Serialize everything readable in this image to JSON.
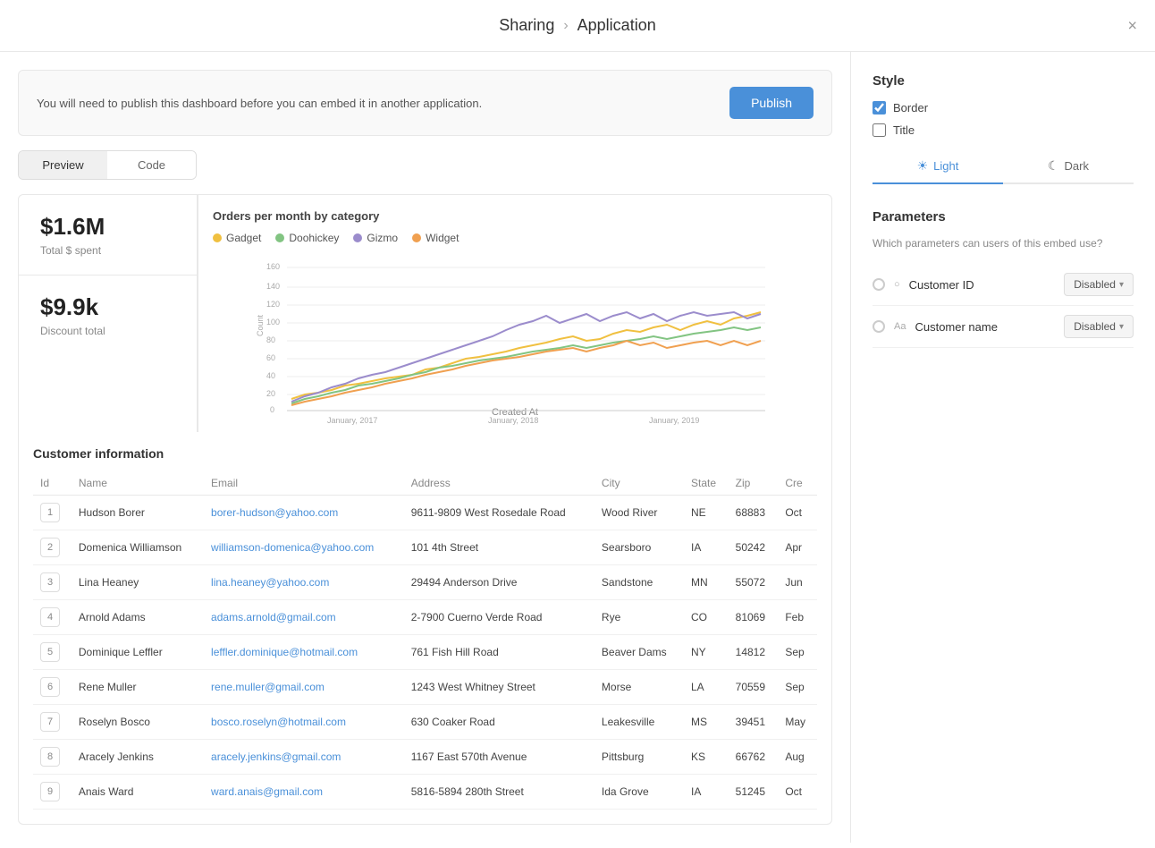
{
  "header": {
    "breadcrumb_sharing": "Sharing",
    "breadcrumb_application": "Application",
    "close_label": "×"
  },
  "publish_banner": {
    "message": "You will need to publish this dashboard before you can embed it in another application.",
    "button_label": "Publish"
  },
  "tabs": [
    {
      "id": "preview",
      "label": "Preview",
      "active": true
    },
    {
      "id": "code",
      "label": "Code",
      "active": false
    }
  ],
  "metrics": [
    {
      "value": "$1.6M",
      "label": "Total $ spent"
    },
    {
      "value": "$9.9k",
      "label": "Discount total"
    }
  ],
  "chart": {
    "title": "Orders per month by category",
    "x_label": "Created At",
    "y_label": "Count",
    "x_ticks": [
      "January, 2017",
      "January, 2018",
      "January, 2019"
    ],
    "legend": [
      {
        "name": "Gadget",
        "color": "#f0c040"
      },
      {
        "name": "Doohickey",
        "color": "#82c482"
      },
      {
        "name": "Gizmo",
        "color": "#9b8ccc"
      },
      {
        "name": "Widget",
        "color": "#f0a050"
      }
    ]
  },
  "customer_table": {
    "title": "Customer information",
    "columns": [
      "Id",
      "Name",
      "Email",
      "Address",
      "City",
      "State",
      "Zip",
      "Cre"
    ],
    "rows": [
      {
        "id": 1,
        "name": "Hudson Borer",
        "email": "borer-hudson@yahoo.com",
        "address": "9611-9809 West Rosedale Road",
        "city": "Wood River",
        "state": "NE",
        "zip": "68883",
        "created": "Oct"
      },
      {
        "id": 2,
        "name": "Domenica Williamson",
        "email": "williamson-domenica@yahoo.com",
        "address": "101 4th Street",
        "city": "Searsboro",
        "state": "IA",
        "zip": "50242",
        "created": "Apr"
      },
      {
        "id": 3,
        "name": "Lina Heaney",
        "email": "lina.heaney@yahoo.com",
        "address": "29494 Anderson Drive",
        "city": "Sandstone",
        "state": "MN",
        "zip": "55072",
        "created": "Jun"
      },
      {
        "id": 4,
        "name": "Arnold Adams",
        "email": "adams.arnold@gmail.com",
        "address": "2-7900 Cuerno Verde Road",
        "city": "Rye",
        "state": "CO",
        "zip": "81069",
        "created": "Feb"
      },
      {
        "id": 5,
        "name": "Dominique Leffler",
        "email": "leffler.dominique@hotmail.com",
        "address": "761 Fish Hill Road",
        "city": "Beaver Dams",
        "state": "NY",
        "zip": "14812",
        "created": "Sep"
      },
      {
        "id": 6,
        "name": "Rene Muller",
        "email": "rene.muller@gmail.com",
        "address": "1243 West Whitney Street",
        "city": "Morse",
        "state": "LA",
        "zip": "70559",
        "created": "Sep"
      },
      {
        "id": 7,
        "name": "Roselyn Bosco",
        "email": "bosco.roselyn@hotmail.com",
        "address": "630 Coaker Road",
        "city": "Leakesville",
        "state": "MS",
        "zip": "39451",
        "created": "May"
      },
      {
        "id": 8,
        "name": "Aracely Jenkins",
        "email": "aracely.jenkins@gmail.com",
        "address": "1167 East 570th Avenue",
        "city": "Pittsburg",
        "state": "KS",
        "zip": "66762",
        "created": "Aug"
      },
      {
        "id": 9,
        "name": "Anais Ward",
        "email": "ward.anais@gmail.com",
        "address": "5816-5894 280th Street",
        "city": "Ida Grove",
        "state": "IA",
        "zip": "51245",
        "created": "Oct"
      }
    ]
  },
  "right_panel": {
    "style_title": "Style",
    "border_label": "Border",
    "border_checked": true,
    "title_label": "Title",
    "title_checked": false,
    "light_label": "Light",
    "dark_label": "Dark",
    "active_theme": "light",
    "params_title": "Parameters",
    "params_question": "Which parameters can users of this embed use?",
    "parameters": [
      {
        "id": "customer_id",
        "name": "Customer ID",
        "status": "Disabled",
        "icon": "○"
      },
      {
        "id": "customer_name",
        "name": "Customer name",
        "status": "Disabled",
        "icon": "Aa"
      }
    ]
  }
}
